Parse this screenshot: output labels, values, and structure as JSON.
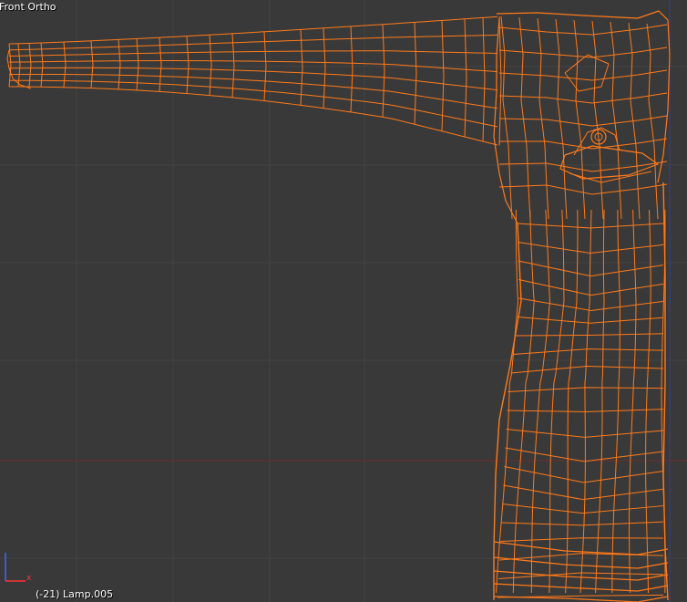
{
  "viewport": {
    "view_name": "Front Ortho",
    "object_info": "(-21) Lamp.005",
    "background_color": "#393939",
    "grid_color": "#434343",
    "x_axis_color": "#6b2f2f",
    "z_axis_color": "#3a3a8a",
    "wire_color": "#ff7a1a"
  },
  "axis_widget": {
    "x_label": "x",
    "x_color": "#ff3333",
    "z_color": "#4466ff"
  },
  "icons": {
    "axis_gizmo": "axis-gizmo-icon"
  }
}
